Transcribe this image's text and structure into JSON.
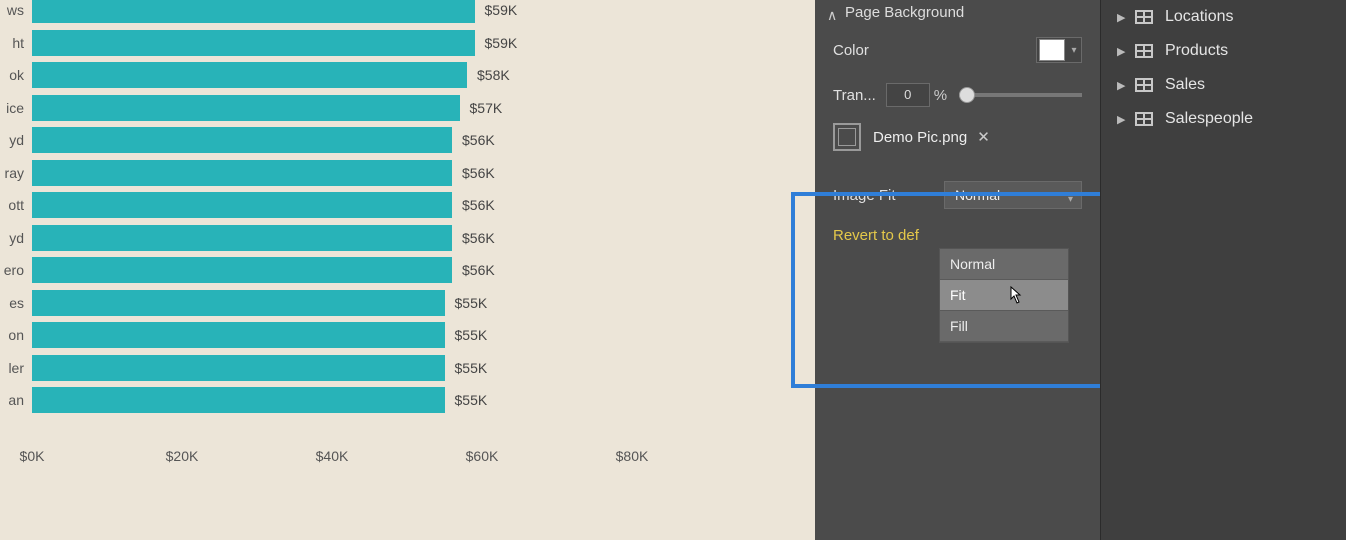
{
  "chart_data": {
    "type": "bar",
    "orientation": "horizontal",
    "xlabel": "",
    "ylabel": "",
    "xlim": [
      0,
      80
    ],
    "xticks": [
      0,
      20,
      40,
      60,
      80
    ],
    "xtick_labels": [
      "$0K",
      "$20K",
      "$40K",
      "$60K",
      "$80K"
    ],
    "bars": [
      {
        "label_fragment": "ws",
        "value": 59,
        "display": "$59K"
      },
      {
        "label_fragment": "ht",
        "value": 59,
        "display": "$59K"
      },
      {
        "label_fragment": "ok",
        "value": 58,
        "display": "$58K"
      },
      {
        "label_fragment": "ice",
        "value": 57,
        "display": "$57K"
      },
      {
        "label_fragment": "yd",
        "value": 56,
        "display": "$56K"
      },
      {
        "label_fragment": "ray",
        "value": 56,
        "display": "$56K"
      },
      {
        "label_fragment": "ott",
        "value": 56,
        "display": "$56K"
      },
      {
        "label_fragment": "yd",
        "value": 56,
        "display": "$56K"
      },
      {
        "label_fragment": "ero",
        "value": 56,
        "display": "$56K"
      },
      {
        "label_fragment": "es",
        "value": 55,
        "display": "$55K"
      },
      {
        "label_fragment": "on",
        "value": 55,
        "display": "$55K"
      },
      {
        "label_fragment": "ler",
        "value": 55,
        "display": "$55K"
      },
      {
        "label_fragment": "an",
        "value": 55,
        "display": "$55K"
      }
    ]
  },
  "format_panel": {
    "section_title": "Page Background",
    "color_label": "Color",
    "color_value": "#FFFFFF",
    "transparency_label": "Tran...",
    "transparency_value": "0",
    "transparency_unit": "%",
    "image_file": "Demo Pic.png",
    "image_fit_label": "Image Fit",
    "image_fit_value": "Normal",
    "image_fit_options": [
      "Normal",
      "Fit",
      "Fill"
    ],
    "image_fit_hover_index": 1,
    "revert_label": "Revert to def"
  },
  "fields_panel": {
    "items": [
      "Locations",
      "Products",
      "Sales",
      "Salespeople"
    ]
  }
}
